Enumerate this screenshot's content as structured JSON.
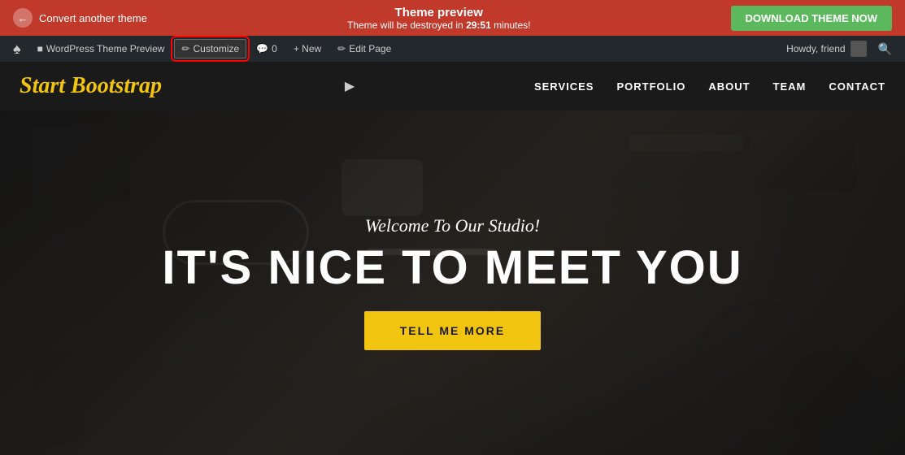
{
  "notification_bar": {
    "back_label": "Convert another theme",
    "preview_title": "Theme preview",
    "preview_subtitle": "Theme will be destroyed in",
    "timer": "29:51",
    "timer_suffix": "minutes!",
    "download_btn": "DOWNLOAD THEME NOW"
  },
  "admin_bar": {
    "wp_icon": "⊞",
    "theme_preview_label": "WordPress Theme Preview",
    "customize_label": "Customize",
    "comments_label": "0",
    "new_label": "+ New",
    "edit_page_label": "Edit Page",
    "howdy_label": "Howdy, friend",
    "search_icon": "🔍"
  },
  "site_header": {
    "logo": "Start Bootstrap",
    "nav_items": [
      {
        "label": "SERVICES"
      },
      {
        "label": "PORTFOLIO"
      },
      {
        "label": "ABOUT"
      },
      {
        "label": "TEAM"
      },
      {
        "label": "CONTACT"
      }
    ]
  },
  "hero": {
    "subtitle": "Welcome To Our Studio!",
    "title": "IT'S NICE TO MEET YOU",
    "cta_label": "TELL ME MORE"
  }
}
